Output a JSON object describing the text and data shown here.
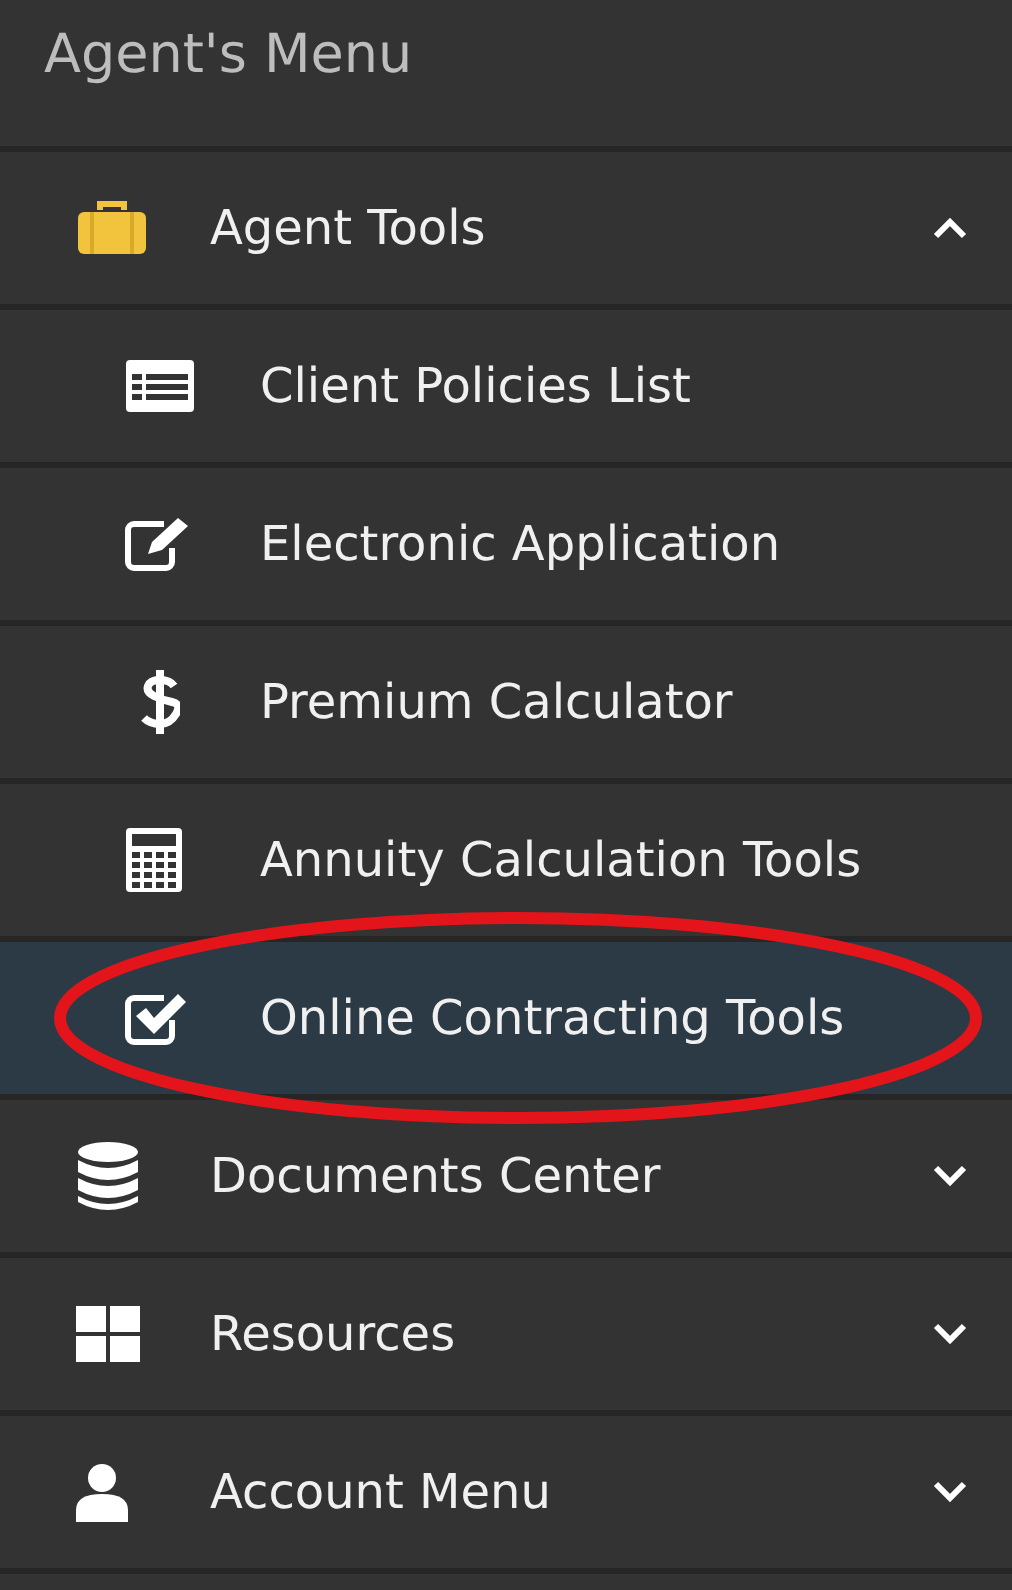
{
  "menu_title": "Agent's Menu",
  "sections": [
    {
      "label": "Agent Tools",
      "expanded": true,
      "children": [
        {
          "label": "Client Policies List",
          "selected": false
        },
        {
          "label": "Electronic Application",
          "selected": false
        },
        {
          "label": "Premium Calculator",
          "selected": false
        },
        {
          "label": "Annuity Calculation Tools",
          "selected": false
        },
        {
          "label": "Online Contracting Tools",
          "selected": true,
          "circled": true
        }
      ]
    },
    {
      "label": "Documents Center",
      "expanded": false
    },
    {
      "label": "Resources",
      "expanded": false
    },
    {
      "label": "Account Menu",
      "expanded": false
    }
  ]
}
